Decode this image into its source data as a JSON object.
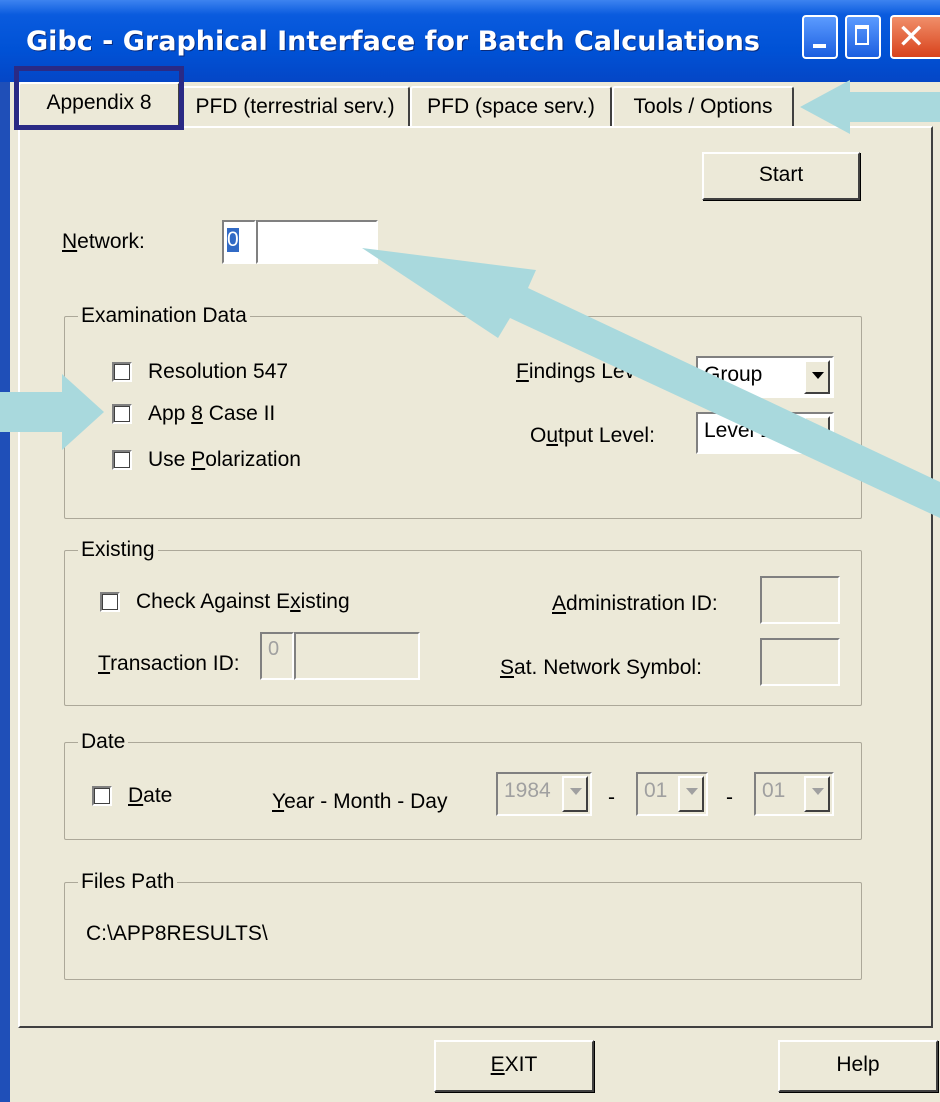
{
  "window": {
    "title": "Gibc - Graphical Interface for Batch Calculations"
  },
  "tabs": [
    {
      "label": "Appendix 8"
    },
    {
      "label": "PFD (terrestrial serv.)"
    },
    {
      "label": "PFD (space serv.)"
    },
    {
      "label": "Tools / Options"
    }
  ],
  "start_button": "Start",
  "network": {
    "label_prefix": "",
    "label_u": "N",
    "label_rest": "etwork:",
    "id_value": "0",
    "name_value": ""
  },
  "examination": {
    "legend": "Examination Data",
    "res547": "Resolution 547",
    "app8_pre": "App ",
    "app8_u": "8",
    "app8_post": " Case II",
    "pol_pre": "Use ",
    "pol_u": "P",
    "pol_post": "olarization",
    "findings_u": "F",
    "findings_rest": "indings Level:",
    "findings_value": "Group",
    "output_u": "u",
    "output_pre": "O",
    "output_post": "tput Level:",
    "output_value": "Level 1"
  },
  "existing": {
    "legend": "Existing",
    "check_pre": "Check Against E",
    "check_u": "x",
    "check_post": "isting",
    "trans_u": "T",
    "trans_rest": "ransaction ID:",
    "trans_value": "0",
    "admin_u": "A",
    "admin_rest": "dministration ID:",
    "sat_u": "S",
    "sat_rest": "at. Network Symbol:"
  },
  "date": {
    "legend": "Date",
    "check_u": "D",
    "check_rest": "ate",
    "ymd_u": "Y",
    "ymd_rest": "ear - Month - Day",
    "year": "1984",
    "month": "01",
    "day": "01",
    "dash": "-"
  },
  "files": {
    "legend": "Files Path",
    "path": "C:\\APP8RESULTS\\"
  },
  "footer": {
    "exit_u": "E",
    "exit_rest": "XIT",
    "help": "Help"
  },
  "colors": {
    "window_bg": "#ece9d8",
    "title_blue": "#0052d6",
    "annotation_arrow": "#a9d9dd",
    "highlight_box": "#2a2a85"
  }
}
